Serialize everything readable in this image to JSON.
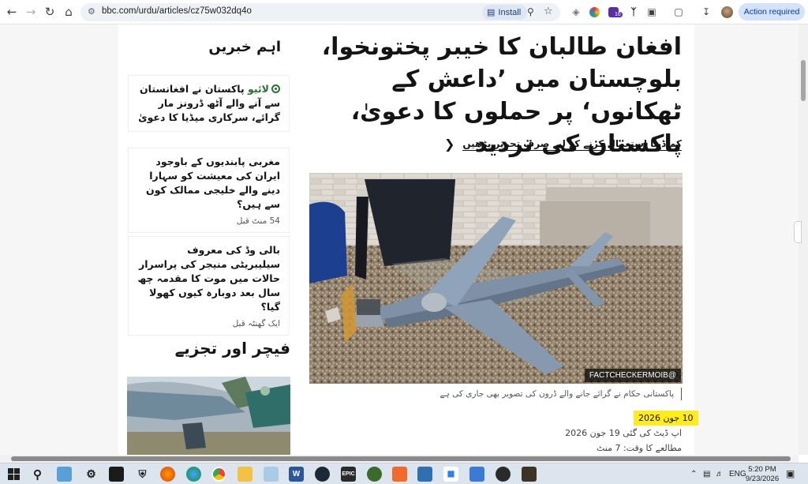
{
  "browser": {
    "url": "bbc.com/urdu/articles/cz75w032dq4o",
    "install_label": "Install",
    "action_required_label": "Action required",
    "extension_badge": "16"
  },
  "article": {
    "headline": "افغان طالبان کا خیبر پختونخوا، بلوچستان میں ’داعش کے ٹھکانوں‘ پر حملوں کا دعویٰ، پاکستان کی تردید",
    "short_read_label": "کم ڈیٹا استعمال کرنے کے لیے صرف تحریر پڑھیں",
    "image_credit": "FACTCHECKERMOIB@",
    "image_caption": "پاکستانی حکام نے گرائے جانے والے ڈرون کی تصویر بھی جاری کی ہے",
    "date": "10 جون 2026",
    "updated": "اپ ڈیٹ کی گئی 19 جون 2026",
    "read_time": "مطالعے کا وقت: 7 منٹ"
  },
  "sidebar": {
    "top_stories_heading": "اہم خبریں",
    "live_label": "لائیو",
    "stories": [
      {
        "title": "پاکستان نے افغانستان سے آنے والے آٹھ ڈرونز مار گرائے، سرکاری میڈیا کا دعویٰ",
        "meta": ""
      },
      {
        "title": "مغربی پابندیوں کے باوجود ایران کی معیشت کو سہارا دینے والے خلیجی ممالک کون سے ہیں؟",
        "meta": "54 منٹ قبل"
      },
      {
        "title": "بالی وڈ کی معروف سیلیبریٹی منیجر کی پراسرار حالات میں موت کا مقدمہ چھ سال بعد دوبارہ کیوں کھولا گیا؟",
        "meta": "ایک گھنٹہ قبل"
      }
    ],
    "features_heading": "فیچر اور تجزیے"
  },
  "taskbar": {
    "lang": "ENG",
    "time": "5:20 PM",
    "date": "9/23/2026"
  }
}
